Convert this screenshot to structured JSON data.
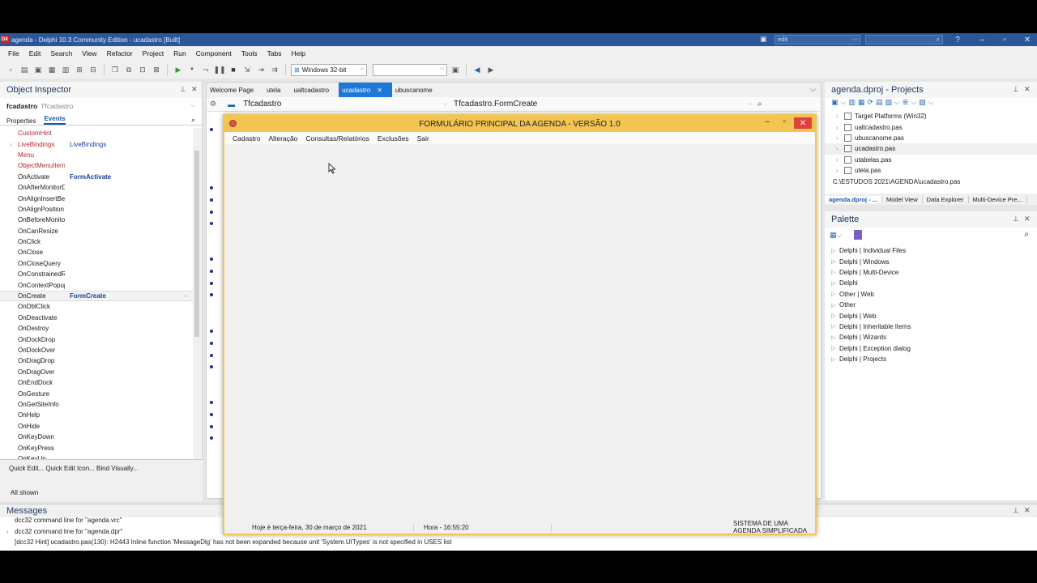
{
  "ide": {
    "title": "agenda - Delphi 10.3 Community Edition - ucadastro [Built]",
    "logo_text": "DX",
    "layout_combo": "edit",
    "menu": [
      "File",
      "Edit",
      "Search",
      "View",
      "Refactor",
      "Project",
      "Run",
      "Component",
      "Tools",
      "Tabs",
      "Help"
    ],
    "platform_combo": "Windows 32-bit"
  },
  "object_inspector": {
    "title": "Object Inspector",
    "selected_object": "fcadastro",
    "selected_type": "Tfcadastro",
    "tabs": [
      "Properties",
      "Events"
    ],
    "active_tab": "Events",
    "events": [
      {
        "name": "CustomHint",
        "value": "",
        "style": "red"
      },
      {
        "name": "LiveBindings",
        "value": "LiveBindings",
        "style": "red"
      },
      {
        "name": "Menu",
        "value": "",
        "style": "red"
      },
      {
        "name": "ObjectMenuItem",
        "value": "",
        "style": "red"
      },
      {
        "name": "OnActivate",
        "value": "FormActivate",
        "style": "plain"
      },
      {
        "name": "OnAfterMonitorDpiChanged",
        "value": "",
        "style": "plain"
      },
      {
        "name": "OnAlignInsertBefore",
        "value": "",
        "style": "plain"
      },
      {
        "name": "OnAlignPosition",
        "value": "",
        "style": "plain"
      },
      {
        "name": "OnBeforeMonitorDpiChanged",
        "value": "",
        "style": "plain"
      },
      {
        "name": "OnCanResize",
        "value": "",
        "style": "plain"
      },
      {
        "name": "OnClick",
        "value": "",
        "style": "plain"
      },
      {
        "name": "OnClose",
        "value": "",
        "style": "plain"
      },
      {
        "name": "OnCloseQuery",
        "value": "",
        "style": "plain"
      },
      {
        "name": "OnConstrainedResize",
        "value": "",
        "style": "plain"
      },
      {
        "name": "OnContextPopup",
        "value": "",
        "style": "plain"
      },
      {
        "name": "OnCreate",
        "value": "FormCreate",
        "style": "plain",
        "selected": true
      },
      {
        "name": "OnDblClick",
        "value": "",
        "style": "plain"
      },
      {
        "name": "OnDeactivate",
        "value": "",
        "style": "plain"
      },
      {
        "name": "OnDestroy",
        "value": "",
        "style": "plain"
      },
      {
        "name": "OnDockDrop",
        "value": "",
        "style": "plain"
      },
      {
        "name": "OnDockOver",
        "value": "",
        "style": "plain"
      },
      {
        "name": "OnDragDrop",
        "value": "",
        "style": "plain"
      },
      {
        "name": "OnDragOver",
        "value": "",
        "style": "plain"
      },
      {
        "name": "OnEndDock",
        "value": "",
        "style": "plain"
      },
      {
        "name": "OnGesture",
        "value": "",
        "style": "plain"
      },
      {
        "name": "OnGetSiteInfo",
        "value": "",
        "style": "plain"
      },
      {
        "name": "OnHelp",
        "value": "",
        "style": "plain"
      },
      {
        "name": "OnHide",
        "value": "",
        "style": "plain"
      },
      {
        "name": "OnKeyDown",
        "value": "",
        "style": "plain"
      },
      {
        "name": "OnKeyPress",
        "value": "",
        "style": "plain"
      },
      {
        "name": "OnKeyUp",
        "value": "",
        "style": "plain"
      }
    ],
    "footer_links": "Quick Edit...  Quick Edit Icon...  Bind Visually...",
    "footer_status": "All shown"
  },
  "editor": {
    "tabs": [
      "Welcome Page",
      "utela",
      "ualtcadastro",
      "ucadastro",
      "ubuscanome"
    ],
    "active_tab": "ucadastro",
    "class_combo": "Tfcadastro",
    "method_combo": "Tfcadastro.FormCreate"
  },
  "form": {
    "caption": "FORMULÁRIO PRINCIPAL DA AGENDA - VERSÃO 1.0",
    "menu": [
      "Cadastro",
      "Alteração",
      "Consultas/Relatórios",
      "Exclusões",
      "Sair"
    ],
    "status": {
      "date": "Hoje é terça-feira, 30 de março de 2021",
      "time": "Hora - 16:55:20",
      "system": "SISTEMA DE UMA AGENDA SIMPLIFICADA"
    }
  },
  "projects": {
    "title": "agenda.dproj - Projects",
    "tree": [
      {
        "label": "Target Platforms (Win32)",
        "selected": false
      },
      {
        "label": "ualtcadastro.pas",
        "selected": false
      },
      {
        "label": "ubuscanome.pas",
        "selected": false
      },
      {
        "label": "ucadastro.pas",
        "selected": true
      },
      {
        "label": "utabelas.pas",
        "selected": false
      },
      {
        "label": "utela.pas",
        "selected": false
      }
    ],
    "path": "C:\\ESTUDOS 2021\\AGENDA\\ucadastro.pas",
    "tabs": [
      "agenda.dproj - ...",
      "Model View",
      "Data Explorer",
      "Multi-Device Pre..."
    ]
  },
  "palette": {
    "title": "Palette",
    "items": [
      "Delphi | Individual Files",
      "Delphi | Windows",
      "Delphi | Multi-Device",
      "Delphi",
      "Other | Web",
      "Other",
      "Delphi | Web",
      "Delphi | Inheritable Items",
      "Delphi | Wizards",
      "Delphi | Exception dialog",
      "Delphi | Projects"
    ]
  },
  "messages": {
    "title": "Messages",
    "lines": [
      "dcc32 command line for \"agenda.vrc\"",
      "dcc32 command line for \"agenda.dpr\"",
      "[dcc32 Hint] ucadastro.pas(130): H2443 Inline function 'MessageDlg' has not been expanded because unit 'System.UITypes' is not specified in USES list"
    ]
  }
}
